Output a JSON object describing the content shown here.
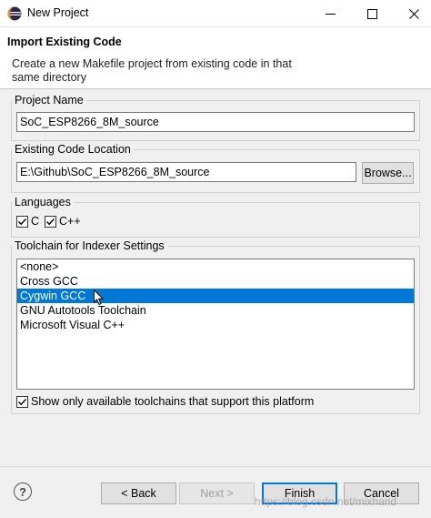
{
  "window": {
    "title": "New Project"
  },
  "header": {
    "title": "Import Existing Code",
    "description": "Create a new Makefile project from existing code in that same directory"
  },
  "project_name": {
    "label": "Project Name",
    "value": "SoC_ESP8266_8M_source"
  },
  "code_location": {
    "label": "Existing Code Location",
    "value": "E:\\Github\\SoC_ESP8266_8M_source",
    "browse_label": "Browse..."
  },
  "languages": {
    "label": "Languages",
    "c": {
      "label": "C",
      "checked": true
    },
    "cpp": {
      "label": "C++",
      "checked": true
    }
  },
  "toolchain": {
    "label": "Toolchain for Indexer Settings",
    "items": [
      "<none>",
      "Cross GCC",
      "Cygwin GCC",
      "GNU Autotools Toolchain",
      "Microsoft Visual C++"
    ],
    "selected_index": 2,
    "show_only_label": "Show only available toolchains that support this platform",
    "show_only_checked": true
  },
  "buttons": {
    "back": "< Back",
    "next": "Next >",
    "finish": "Finish",
    "cancel": "Cancel"
  },
  "watermark": "https://blog.csdn.net/mixhand",
  "colors": {
    "selection": "#0078d7",
    "window_bg": "#f0f0f0"
  }
}
